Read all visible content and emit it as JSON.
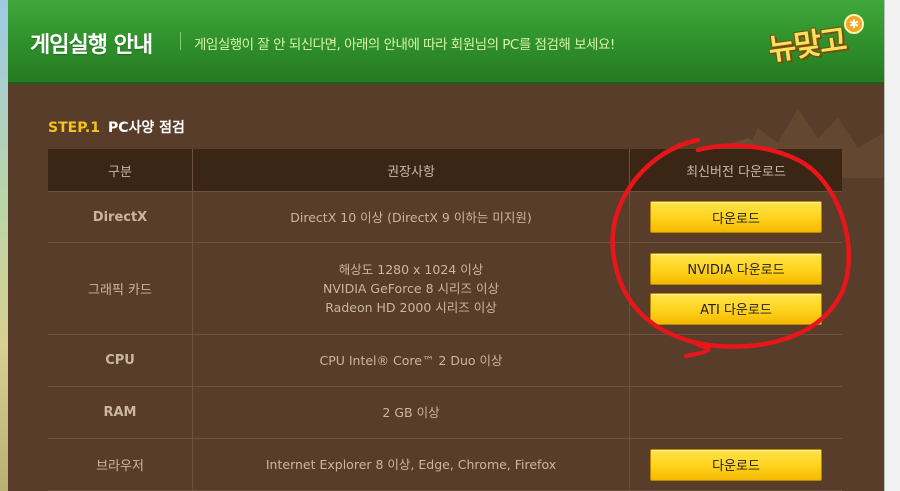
{
  "header": {
    "title": "게임실행 안내",
    "subtitle": "게임실행이 잘 안 되신다면, 아래의 안내에 따라 회원님의 PC를 점검해 보세요!",
    "logo_text": "뉴맞고"
  },
  "step": {
    "number": "STEP.1",
    "title": "PC사양 점검"
  },
  "table": {
    "headers": [
      "구분",
      "권장사항",
      "최신버전 다운로드"
    ],
    "rows": [
      {
        "label": "DirectX",
        "lines": [
          "DirectX 10 이상 (DirectX 9 이하는 미지원)"
        ],
        "buttons": [
          "다운로드"
        ]
      },
      {
        "label": "그래픽 카드",
        "lines": [
          "해상도 1280 x 1024 이상",
          "NVIDIA GeForce 8 시리즈 이상",
          "Radeon HD 2000 시리즈 이상"
        ],
        "buttons": [
          "NVIDIA 다운로드",
          "ATI 다운로드"
        ]
      },
      {
        "label": "CPU",
        "lines": [
          "CPU Intel® Core™ 2 Duo 이상"
        ],
        "buttons": []
      },
      {
        "label": "RAM",
        "lines": [
          "2 GB 이상"
        ],
        "buttons": []
      },
      {
        "label": "브라우저",
        "lines": [
          "Internet Explorer 8 이상, Edge, Chrome, Firefox"
        ],
        "buttons": [
          "다운로드"
        ]
      }
    ]
  },
  "colors": {
    "header_green": "#2e8f2a",
    "background_brown": "#573d2a",
    "table_header": "#3b2514",
    "button_yellow": "#ffd21c",
    "step_accent": "#f7c21a",
    "annotation_red": "#e8161b"
  }
}
